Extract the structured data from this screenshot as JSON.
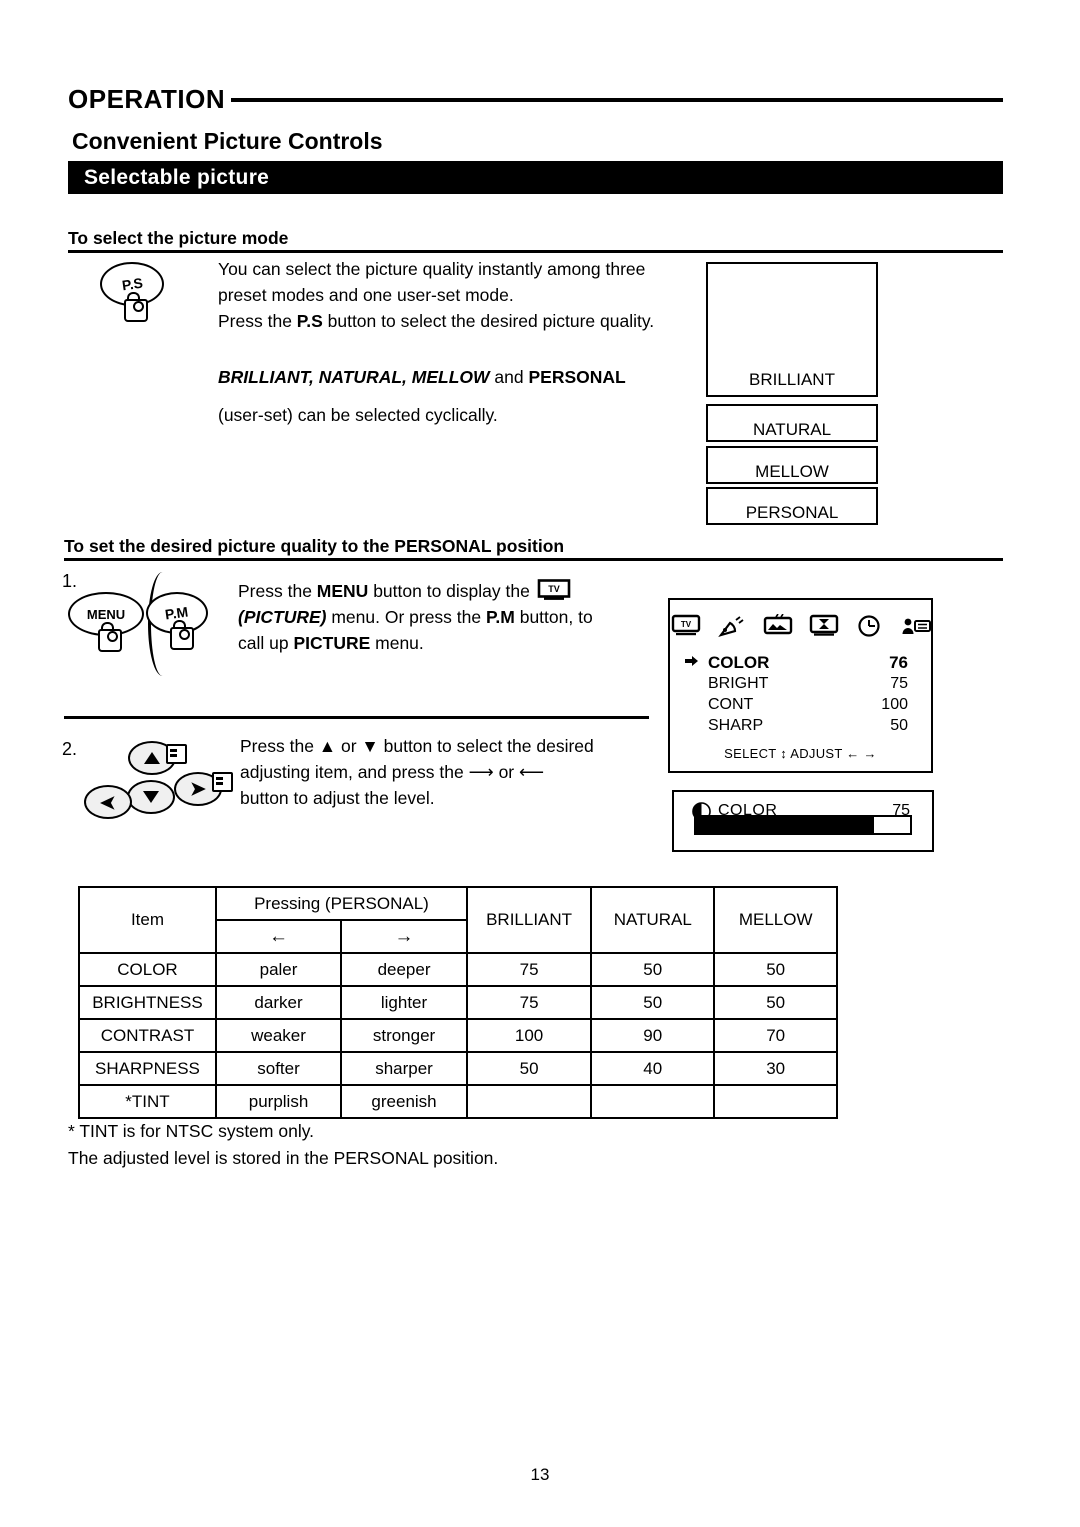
{
  "header": {
    "section_title": "OPERATION",
    "subtitle": "Convenient Picture Controls",
    "band_title": "Selectable picture"
  },
  "section_select_mode": {
    "heading": "To select the picture mode",
    "button_label": "P.S",
    "button_icon": "hand-press-icon",
    "paragraph_line1": "You can select the picture quality instantly among three",
    "paragraph_line2": "preset modes and one user-set mode.",
    "paragraph_line3_a": "Press the ",
    "paragraph_line3_b": "P.S",
    "paragraph_line3_c": " button to select the desired picture quality.",
    "modes_line_italic": "BRILLIANT, NATURAL, MELLOW",
    "modes_line_and": " and ",
    "modes_line_bold": "PERSONAL",
    "modes_line2": "(user-set) can be selected cyclically.",
    "mode_boxes": [
      "BRILLIANT",
      "NATURAL",
      "MELLOW",
      "PERSONAL"
    ]
  },
  "section_personal": {
    "heading": "To set the desired picture quality to the PERSONAL position",
    "step1": {
      "number": "1.",
      "key_menu": "MENU",
      "key_pm": "P.M",
      "line1_a": "Press the ",
      "line1_b": "MENU",
      "line1_c": " button to display the ",
      "line1_icon": "tv-icon",
      "line2_a": "(PICTURE)",
      "line2_b": " menu. Or press the ",
      "line2_c": "P.M",
      "line2_d": " button, to",
      "line3_a": "call up ",
      "line3_b": "PICTURE",
      "line3_c": " menu."
    },
    "step2": {
      "number": "2.",
      "keys": [
        "up-arrow-key",
        "down-arrow-key",
        "right-arrow-key",
        "left-arrow-key"
      ],
      "line1_a": "Press the ",
      "line1_up": "▲",
      "line1_b": " or ",
      "line1_down": "▼",
      "line1_c": " button to select the desired",
      "line2_a": "adjusting item, and press the ",
      "line2_right": "⟶",
      "line2_b": " or ",
      "line2_left": "⟵",
      "line3": "button to adjust the level."
    }
  },
  "osd_menu": {
    "icons": [
      "tv-icon",
      "satellite-dish-icon",
      "picture-icon",
      "hourglass-tv-icon",
      "clock-icon",
      "caption-person-icon"
    ],
    "rows": [
      {
        "label": "COLOR",
        "value": "76",
        "selected": true
      },
      {
        "label": "BRIGHT",
        "value": "75",
        "selected": false
      },
      {
        "label": "CONT",
        "value": "100",
        "selected": false
      },
      {
        "label": "SHARP",
        "value": "50",
        "selected": false
      }
    ],
    "footer_select": "SELECT",
    "footer_adjust": "ADJUST"
  },
  "osd_bar": {
    "icon": "contrast-circle-icon",
    "label": "COLOR",
    "value": "75",
    "fill_percent": 83
  },
  "chart_data": {
    "type": "table",
    "title": "Picture adjustment items and preset levels",
    "columns": [
      "Item",
      "Pressing (PERSONAL) ←",
      "Pressing (PERSONAL) →",
      "BRILLIANT",
      "NATURAL",
      "MELLOW"
    ],
    "header": {
      "item": "Item",
      "pressing": "Pressing (PERSONAL)",
      "left_arrow": "←",
      "right_arrow": "→",
      "presets": [
        "BRILLIANT",
        "NATURAL",
        "MELLOW"
      ]
    },
    "rows": [
      {
        "item": "COLOR",
        "left": "paler",
        "right": "deeper",
        "brilliant": "75",
        "natural": "50",
        "mellow": "50"
      },
      {
        "item": "BRIGHTNESS",
        "left": "darker",
        "right": "lighter",
        "brilliant": "75",
        "natural": "50",
        "mellow": "50"
      },
      {
        "item": "CONTRAST",
        "left": "weaker",
        "right": "stronger",
        "brilliant": "100",
        "natural": "90",
        "mellow": "70"
      },
      {
        "item": "SHARPNESS",
        "left": "softer",
        "right": "sharper",
        "brilliant": "50",
        "natural": "40",
        "mellow": "30"
      },
      {
        "item": "*TINT",
        "left": "purplish",
        "right": "greenish",
        "brilliant": "",
        "natural": "",
        "mellow": ""
      }
    ]
  },
  "footnotes": {
    "line1": "* TINT is for NTSC system only.",
    "line2": "The adjusted level is stored in the PERSONAL position."
  },
  "page_number": "13"
}
